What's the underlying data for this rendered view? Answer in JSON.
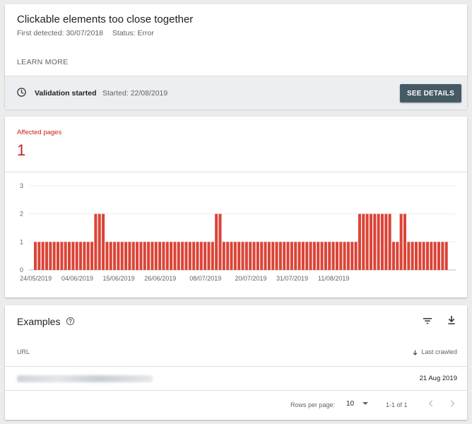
{
  "issue": {
    "title": "Clickable elements too close together",
    "first_detected": "First detected: 30/07/2018",
    "status": "Status: Error",
    "learn_more": "LEARN MORE"
  },
  "validation": {
    "status_label": "Validation started",
    "started": "Started: 22/08/2019",
    "button_label": "SEE DETAILS",
    "icon": "clock-icon"
  },
  "affected": {
    "label": "Affected pages",
    "count": "1",
    "color": "#c5221f"
  },
  "chart_data": {
    "type": "bar",
    "bar_color": "#db4437",
    "ylim": [
      0,
      3
    ],
    "yticks": [
      "0",
      "1",
      "2",
      "3"
    ],
    "grid": true,
    "xtick_labels": [
      "24/05/2019",
      "04/06/2019",
      "15/06/2019",
      "26/06/2019",
      "08/07/2019",
      "20/07/2019",
      "31/07/2019",
      "11/08/2019"
    ],
    "xtick_indices": [
      0,
      11,
      22,
      33,
      45,
      57,
      68,
      79
    ],
    "values": [
      1,
      1,
      1,
      1,
      1,
      1,
      1,
      1,
      1,
      1,
      1,
      1,
      1,
      1,
      1,
      1,
      2,
      2,
      2,
      1,
      1,
      1,
      1,
      1,
      1,
      1,
      1,
      1,
      1,
      1,
      1,
      1,
      1,
      1,
      1,
      1,
      1,
      1,
      1,
      1,
      1,
      1,
      1,
      1,
      1,
      1,
      1,
      1,
      2,
      2,
      1,
      1,
      1,
      1,
      1,
      1,
      1,
      1,
      1,
      1,
      1,
      1,
      1,
      1,
      1,
      1,
      1,
      1,
      1,
      1,
      1,
      1,
      1,
      1,
      1,
      1,
      1,
      1,
      1,
      1,
      1,
      1,
      1,
      1,
      1,
      1,
      2,
      2,
      2,
      2,
      2,
      2,
      2,
      2,
      2,
      1,
      1,
      2,
      2,
      1,
      1,
      1,
      1,
      1,
      1,
      1,
      1,
      1,
      1,
      1
    ]
  },
  "examples": {
    "title": "Examples",
    "col_url": "URL",
    "col_last_crawled": "Last crawled",
    "rows": [
      {
        "date": "21 Aug 2019"
      }
    ],
    "rows_per_page_label": "Rows per page:",
    "rows_per_page": "10",
    "range": "1-1 of 1"
  }
}
